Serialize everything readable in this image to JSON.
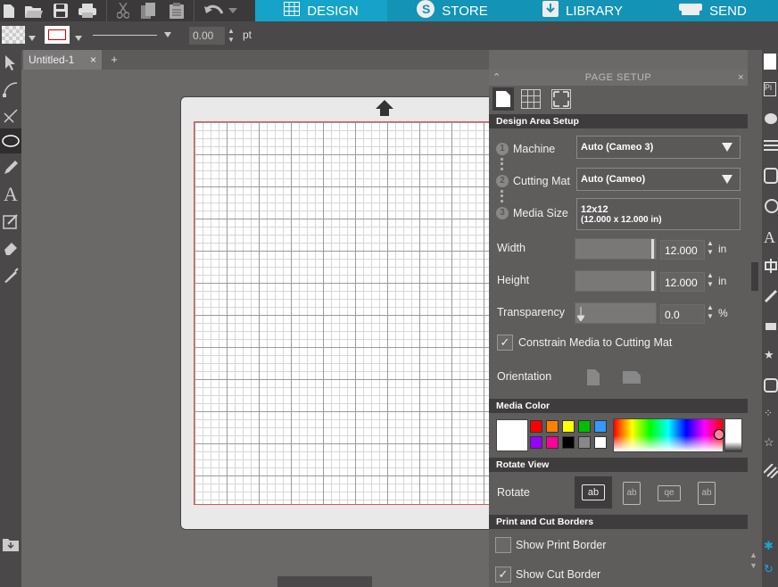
{
  "topbar": {
    "icons": [
      "new-file-icon",
      "open-folder-icon",
      "save-icon",
      "print-icon",
      "cut-icon",
      "copy-icon",
      "paste-icon",
      "undo-icon"
    ],
    "tabs": [
      {
        "label": "DESIGN",
        "icon": "grid-icon",
        "active": true
      },
      {
        "label": "STORE",
        "icon": "store-icon",
        "active": false
      },
      {
        "label": "LIBRARY",
        "icon": "download-icon",
        "active": false
      },
      {
        "label": "SEND",
        "icon": "cutter-icon",
        "active": false
      }
    ],
    "accent": "#16a3c9"
  },
  "toolbar": {
    "line_width_value": "0.00",
    "line_width_unit": "pt"
  },
  "document_tab": {
    "title": "Untitled-1",
    "close": "×",
    "add": "+"
  },
  "page_setup": {
    "title": "PAGE SETUP",
    "close": "×",
    "section_design_area": "Design Area Setup",
    "machine_label": "Machine",
    "machine_value": "Auto (Cameo 3)",
    "step1": "1",
    "step2": "2",
    "step3": "3",
    "cutting_mat_label": "Cutting Mat",
    "cutting_mat_value": "Auto (Cameo)",
    "media_size_label": "Media Size",
    "media_size_value": "12x12",
    "media_size_detail": "(12.000 x 12.000 in)",
    "width_label": "Width",
    "width_value": "12.000",
    "width_unit": "in",
    "height_label": "Height",
    "height_value": "12.000",
    "height_unit": "in",
    "transparency_label": "Transparency",
    "transparency_value": "0.0",
    "transparency_unit": "%",
    "constrain_label": "Constrain Media to Cutting Mat",
    "constrain_checked": true,
    "orientation_label": "Orientation",
    "section_media_color": "Media Color",
    "swatches": [
      "#ff0000",
      "#ff8000",
      "#ffff00",
      "#00c000",
      "#3399ff",
      "#9900ff",
      "#ff0099",
      "#000000",
      "#888888",
      "#ffffff"
    ],
    "section_rotate": "Rotate View",
    "rotate_label": "Rotate",
    "section_print_cut": "Print and Cut Borders",
    "show_print_border_label": "Show Print Border",
    "show_print_border_checked": false,
    "show_cut_border_label": "Show Cut Border",
    "show_cut_border_checked": true
  }
}
